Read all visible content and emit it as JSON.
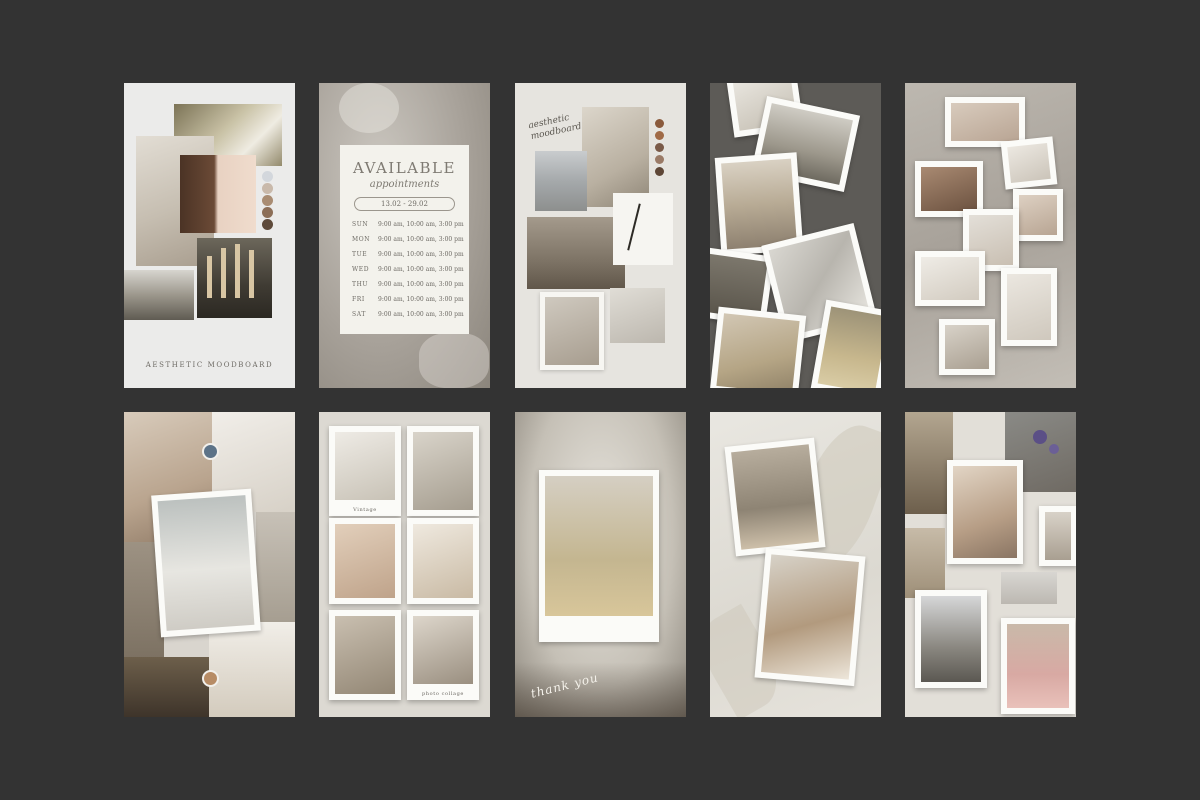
{
  "templates": {
    "moodboard_caption": "AESTHETIC MOODBOARD",
    "schedule": {
      "title": "AVAILABLE",
      "subtitle": "appointments",
      "dates": "13.02 - 29.02",
      "rows": [
        {
          "day": "SUN",
          "times": "9:00 am, 10:00 am, 3:00 pm"
        },
        {
          "day": "MON",
          "times": "9:00 am, 10:00 am, 3:00 pm"
        },
        {
          "day": "TUE",
          "times": "9:00 am, 10:00 am, 3:00 pm"
        },
        {
          "day": "WED",
          "times": "9:00 am, 10:00 am, 3:00 pm"
        },
        {
          "day": "THU",
          "times": "9:00 am, 10:00 am, 3:00 pm"
        },
        {
          "day": "FRI",
          "times": "9:00 am, 10:00 am, 3:00 pm"
        },
        {
          "day": "SAT",
          "times": "9:00 am, 10:00 am, 3:00 pm"
        }
      ]
    },
    "script_title": "aesthetic moodboard",
    "collage_captions": {
      "vintage": "Vintage",
      "photo_collage": "photo collage"
    },
    "thank_you": "thank you"
  },
  "palette": {
    "background": "#333333",
    "swatches": [
      "#d3d7dc",
      "#c9b9aa",
      "#a98c72",
      "#8c6e57",
      "#5e4a3a"
    ],
    "brown_swatches": [
      "#8a5a3c",
      "#a06a46",
      "#7a5a48",
      "#9a7a66",
      "#5e4636"
    ],
    "accent_blue": "#5d7388",
    "accent_tan": "#b78c66"
  }
}
